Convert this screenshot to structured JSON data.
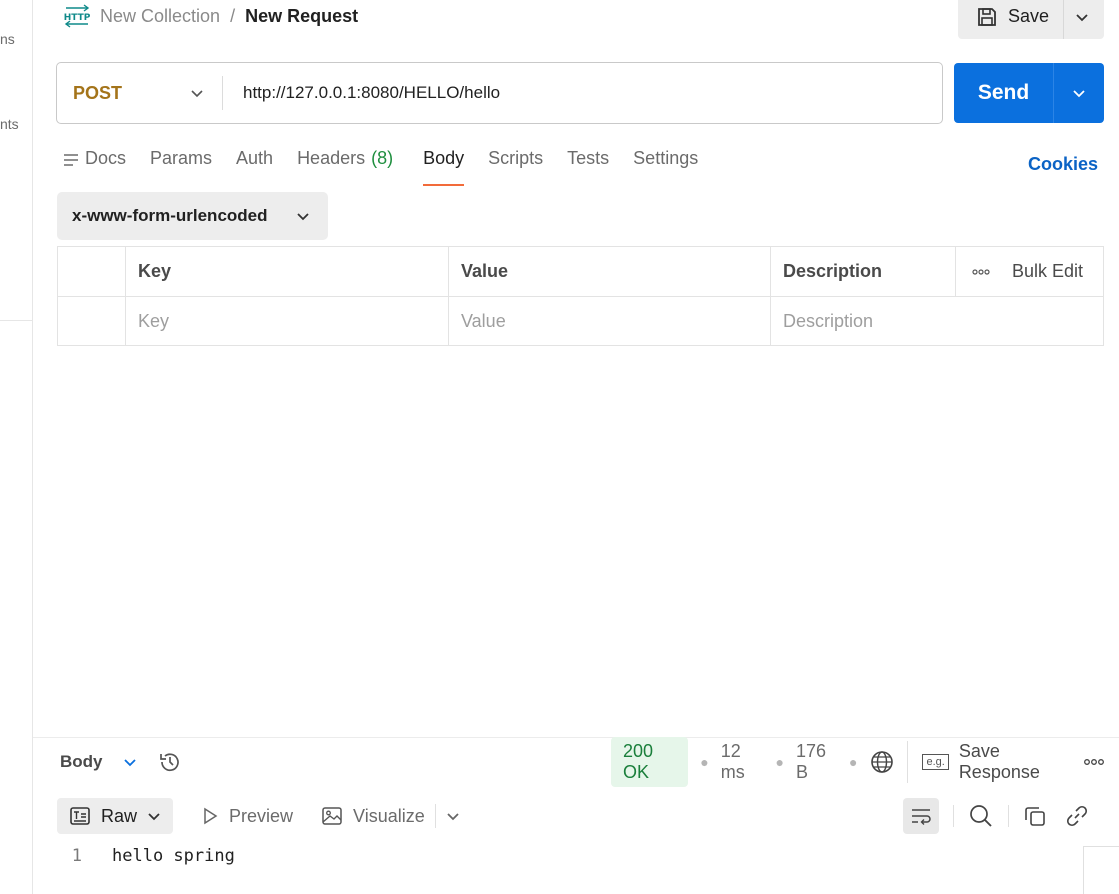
{
  "sidebar": {
    "fragments": [
      "ns",
      "nts"
    ]
  },
  "breadcrumb": {
    "collection": "New Collection",
    "separator": "/",
    "request": "New Request"
  },
  "toolbar": {
    "save_label": "Save"
  },
  "request": {
    "method": "POST",
    "url": "http://127.0.0.1:8080/HELLO/hello",
    "send_label": "Send"
  },
  "tabs": [
    {
      "label": "Docs"
    },
    {
      "label": "Params"
    },
    {
      "label": "Auth"
    },
    {
      "label": "Headers",
      "count": "(8)"
    },
    {
      "label": "Body",
      "active": true
    },
    {
      "label": "Scripts"
    },
    {
      "label": "Tests"
    },
    {
      "label": "Settings"
    }
  ],
  "cookies_label": "Cookies",
  "body_type": "x-www-form-urlencoded",
  "kv_table": {
    "headers": {
      "key": "Key",
      "value": "Value",
      "description": "Description",
      "bulk_edit": "Bulk Edit"
    },
    "placeholders": {
      "key": "Key",
      "value": "Value",
      "description": "Description"
    }
  },
  "response": {
    "tab_label": "Body",
    "status": "200 OK",
    "time": "12 ms",
    "size": "176 B",
    "save_response_label": "Save Response",
    "eg_label": "e.g.",
    "views": {
      "raw": "Raw",
      "preview": "Preview",
      "visualize": "Visualize"
    },
    "lines": [
      {
        "number": "1",
        "text": "hello spring"
      }
    ]
  },
  "colors": {
    "accent": "#0b70de",
    "method": "#a4741a",
    "active_tab": "#f26b3a",
    "status_ok": "#1a7f3b"
  }
}
